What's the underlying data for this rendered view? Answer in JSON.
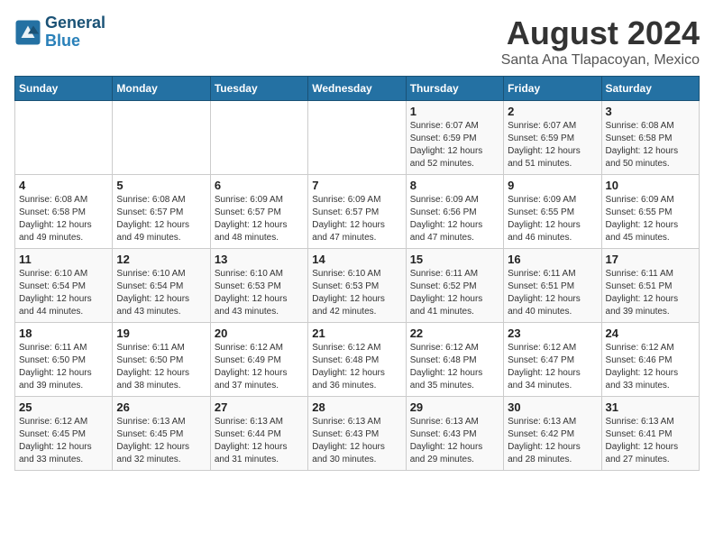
{
  "header": {
    "logo_line1": "General",
    "logo_line2": "Blue",
    "title": "August 2024",
    "subtitle": "Santa Ana Tlapacoyan, Mexico"
  },
  "weekdays": [
    "Sunday",
    "Monday",
    "Tuesday",
    "Wednesday",
    "Thursday",
    "Friday",
    "Saturday"
  ],
  "weeks": [
    [
      {
        "day": "",
        "info": ""
      },
      {
        "day": "",
        "info": ""
      },
      {
        "day": "",
        "info": ""
      },
      {
        "day": "",
        "info": ""
      },
      {
        "day": "1",
        "info": "Sunrise: 6:07 AM\nSunset: 6:59 PM\nDaylight: 12 hours\nand 52 minutes."
      },
      {
        "day": "2",
        "info": "Sunrise: 6:07 AM\nSunset: 6:59 PM\nDaylight: 12 hours\nand 51 minutes."
      },
      {
        "day": "3",
        "info": "Sunrise: 6:08 AM\nSunset: 6:58 PM\nDaylight: 12 hours\nand 50 minutes."
      }
    ],
    [
      {
        "day": "4",
        "info": "Sunrise: 6:08 AM\nSunset: 6:58 PM\nDaylight: 12 hours\nand 49 minutes."
      },
      {
        "day": "5",
        "info": "Sunrise: 6:08 AM\nSunset: 6:57 PM\nDaylight: 12 hours\nand 49 minutes."
      },
      {
        "day": "6",
        "info": "Sunrise: 6:09 AM\nSunset: 6:57 PM\nDaylight: 12 hours\nand 48 minutes."
      },
      {
        "day": "7",
        "info": "Sunrise: 6:09 AM\nSunset: 6:57 PM\nDaylight: 12 hours\nand 47 minutes."
      },
      {
        "day": "8",
        "info": "Sunrise: 6:09 AM\nSunset: 6:56 PM\nDaylight: 12 hours\nand 47 minutes."
      },
      {
        "day": "9",
        "info": "Sunrise: 6:09 AM\nSunset: 6:55 PM\nDaylight: 12 hours\nand 46 minutes."
      },
      {
        "day": "10",
        "info": "Sunrise: 6:09 AM\nSunset: 6:55 PM\nDaylight: 12 hours\nand 45 minutes."
      }
    ],
    [
      {
        "day": "11",
        "info": "Sunrise: 6:10 AM\nSunset: 6:54 PM\nDaylight: 12 hours\nand 44 minutes."
      },
      {
        "day": "12",
        "info": "Sunrise: 6:10 AM\nSunset: 6:54 PM\nDaylight: 12 hours\nand 43 minutes."
      },
      {
        "day": "13",
        "info": "Sunrise: 6:10 AM\nSunset: 6:53 PM\nDaylight: 12 hours\nand 43 minutes."
      },
      {
        "day": "14",
        "info": "Sunrise: 6:10 AM\nSunset: 6:53 PM\nDaylight: 12 hours\nand 42 minutes."
      },
      {
        "day": "15",
        "info": "Sunrise: 6:11 AM\nSunset: 6:52 PM\nDaylight: 12 hours\nand 41 minutes."
      },
      {
        "day": "16",
        "info": "Sunrise: 6:11 AM\nSunset: 6:51 PM\nDaylight: 12 hours\nand 40 minutes."
      },
      {
        "day": "17",
        "info": "Sunrise: 6:11 AM\nSunset: 6:51 PM\nDaylight: 12 hours\nand 39 minutes."
      }
    ],
    [
      {
        "day": "18",
        "info": "Sunrise: 6:11 AM\nSunset: 6:50 PM\nDaylight: 12 hours\nand 39 minutes."
      },
      {
        "day": "19",
        "info": "Sunrise: 6:11 AM\nSunset: 6:50 PM\nDaylight: 12 hours\nand 38 minutes."
      },
      {
        "day": "20",
        "info": "Sunrise: 6:12 AM\nSunset: 6:49 PM\nDaylight: 12 hours\nand 37 minutes."
      },
      {
        "day": "21",
        "info": "Sunrise: 6:12 AM\nSunset: 6:48 PM\nDaylight: 12 hours\nand 36 minutes."
      },
      {
        "day": "22",
        "info": "Sunrise: 6:12 AM\nSunset: 6:48 PM\nDaylight: 12 hours\nand 35 minutes."
      },
      {
        "day": "23",
        "info": "Sunrise: 6:12 AM\nSunset: 6:47 PM\nDaylight: 12 hours\nand 34 minutes."
      },
      {
        "day": "24",
        "info": "Sunrise: 6:12 AM\nSunset: 6:46 PM\nDaylight: 12 hours\nand 33 minutes."
      }
    ],
    [
      {
        "day": "25",
        "info": "Sunrise: 6:12 AM\nSunset: 6:45 PM\nDaylight: 12 hours\nand 33 minutes."
      },
      {
        "day": "26",
        "info": "Sunrise: 6:13 AM\nSunset: 6:45 PM\nDaylight: 12 hours\nand 32 minutes."
      },
      {
        "day": "27",
        "info": "Sunrise: 6:13 AM\nSunset: 6:44 PM\nDaylight: 12 hours\nand 31 minutes."
      },
      {
        "day": "28",
        "info": "Sunrise: 6:13 AM\nSunset: 6:43 PM\nDaylight: 12 hours\nand 30 minutes."
      },
      {
        "day": "29",
        "info": "Sunrise: 6:13 AM\nSunset: 6:43 PM\nDaylight: 12 hours\nand 29 minutes."
      },
      {
        "day": "30",
        "info": "Sunrise: 6:13 AM\nSunset: 6:42 PM\nDaylight: 12 hours\nand 28 minutes."
      },
      {
        "day": "31",
        "info": "Sunrise: 6:13 AM\nSunset: 6:41 PM\nDaylight: 12 hours\nand 27 minutes."
      }
    ]
  ]
}
